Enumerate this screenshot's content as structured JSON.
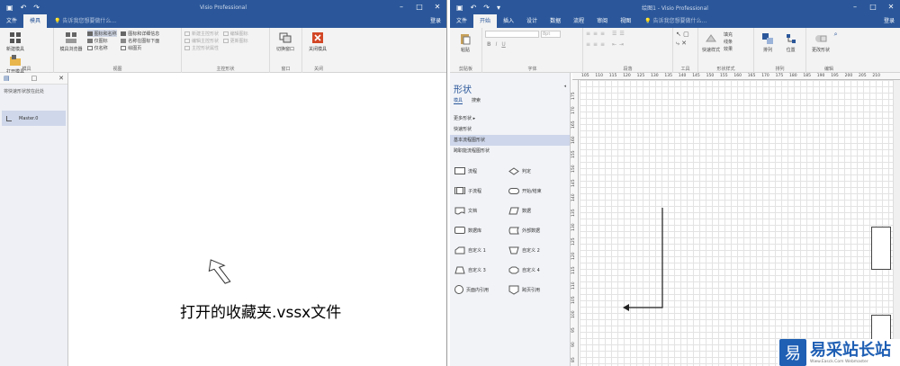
{
  "left_window": {
    "title": "Visio Professional",
    "tabs": [
      "文件",
      "模具"
    ],
    "active_tab": 1,
    "tell_me": "告诉我您想要做什么...",
    "login": "登录",
    "ribbon": {
      "new_stencil": "新建模具",
      "open_stencil": "打开模具",
      "group_stencil": "模具",
      "stencil_browser": "模具浏览器",
      "icon_and_name": "图标和名称",
      "icon_only": "仅图标",
      "name_only": "仅名称",
      "icon_details": "图标和详细信息",
      "name_under_icon": "名称在图标下面",
      "drawing_page": "绘图页",
      "group_view": "视图",
      "new_master": "新建主控形状",
      "edit_master": "编辑主控形状",
      "master_props": "主控形状属性",
      "edit_icon": "编辑图标",
      "update_icon": "更新图标",
      "group_master": "主控形状",
      "switch_window": "切换窗口",
      "group_window": "窗口",
      "close_stencil": "关闭模具",
      "group_close": "关闭"
    },
    "pane_note": "将快速形状放在此处",
    "master_name": "Master.0",
    "caption": "打开的收藏夹.vssx文件"
  },
  "right_window": {
    "title": "绘图1 - Visio Professional",
    "tabs": [
      "文件",
      "开始",
      "插入",
      "设计",
      "数据",
      "流程",
      "审阅",
      "视图"
    ],
    "active_tab": 1,
    "tell_me": "告诉我您想要做什么...",
    "login": "登录",
    "ribbon": {
      "paste": "粘贴",
      "group_clipboard": "剪贴板",
      "font_size": "8pt",
      "group_font": "字体",
      "group_paragraph": "段落",
      "group_tools": "工具",
      "quick_styles": "快速样式",
      "fill": "填充",
      "line": "线条",
      "effects": "效果",
      "group_shape_styles": "形状样式",
      "arrange": "排列",
      "position": "位置",
      "group_arrange": "排列",
      "change_shape": "更改形状",
      "group_edit": "编辑"
    },
    "shapes_pane": {
      "heading": "形状",
      "tab_stencils": "模具",
      "tab_search": "搜索",
      "more_shapes": "更多形状",
      "quick_shapes": "快速形状",
      "basic_flowchart": "基本流程图形状",
      "cross_functional": "跨职能流程图形状",
      "items": [
        "流程",
        "判定",
        "子流程",
        "开始/结束",
        "文档",
        "数据",
        "数据库",
        "外部数据",
        "自定义 1",
        "自定义 2",
        "自定义 3",
        "自定义 4",
        "页面内引用",
        "跨页引用"
      ]
    },
    "ruler_top": [
      "105",
      "110",
      "115",
      "120",
      "125",
      "130",
      "135",
      "140",
      "145",
      "150",
      "155",
      "160",
      "165",
      "170",
      "175",
      "180",
      "185",
      "190",
      "195",
      "200",
      "205",
      "210"
    ],
    "ruler_left": [
      "175",
      "170",
      "165",
      "160",
      "155",
      "150",
      "145",
      "140",
      "135",
      "130",
      "125",
      "120",
      "115",
      "110",
      "105",
      "100",
      "95",
      "90",
      "85"
    ]
  },
  "watermark": {
    "logo": "易",
    "text": "易采站长站",
    "sub": "Www.Easck.Com Webmaster"
  },
  "colors": {
    "accent": "#2b579a",
    "watermark": "#1f5fb4"
  }
}
